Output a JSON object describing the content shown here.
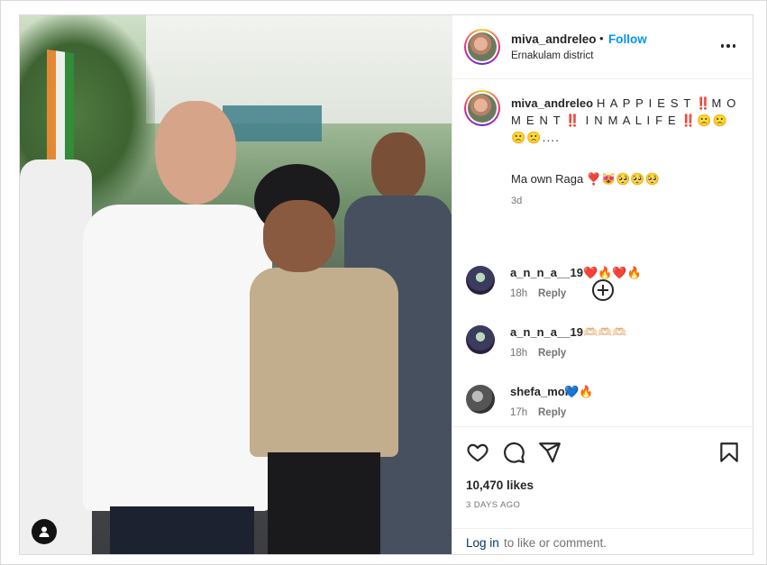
{
  "header": {
    "username": "miva_andreleo",
    "separator": "•",
    "follow_label": "Follow",
    "location": "Ernakulam district"
  },
  "caption": {
    "username": "miva_andreleo",
    "text_line1": "H A P P I E S T ‼️M O M E N T ‼️ I N M A L I F E ‼️🙁🙁🙁🙁....",
    "text_line2": "Ma own Raga ❣️😻🥺🥺🥺",
    "time": "3d"
  },
  "comments": [
    {
      "username": "a_n_n_a__19",
      "text": "❤️🔥❤️🔥",
      "time": "18h",
      "reply_label": "Reply"
    },
    {
      "username": "a_n_n_a__19",
      "text": "🫶🏻🫶🏻🫶🏻",
      "time": "18h",
      "reply_label": "Reply"
    },
    {
      "username": "shefa_mol",
      "text": "💙🔥",
      "time": "17h",
      "reply_label": "Reply"
    }
  ],
  "actions": {
    "icons": [
      "heart-icon",
      "comment-icon",
      "share-icon",
      "bookmark-icon"
    ],
    "likes": "10,470 likes",
    "posted": "3 DAYS AGO"
  },
  "login": {
    "link_label": "Log in",
    "rest_text": "to like or comment."
  },
  "colors": {
    "follow": "#0095f6",
    "link": "#00376b",
    "muted": "#737373",
    "text": "#262626"
  }
}
